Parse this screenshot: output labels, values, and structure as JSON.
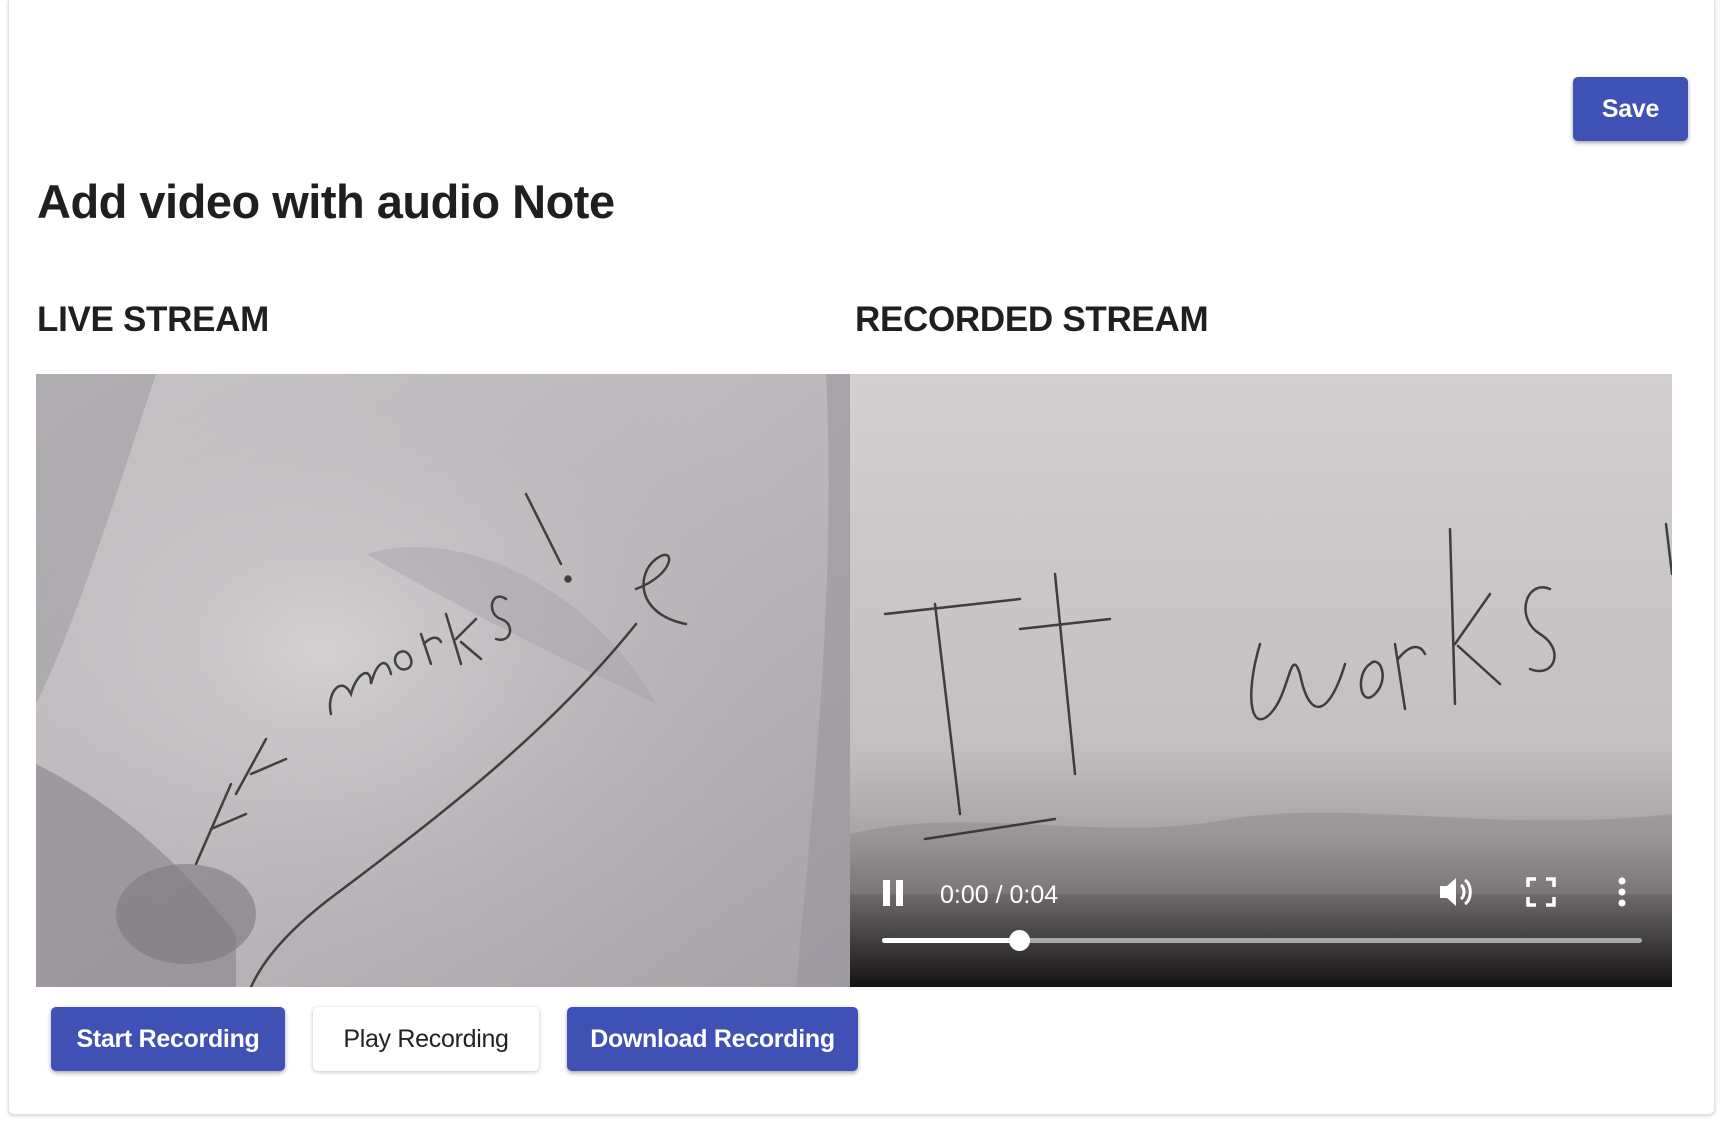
{
  "header": {
    "save_label": "Save",
    "title": "Add video with audio Note"
  },
  "live": {
    "label": "LIVE STREAM"
  },
  "recorded": {
    "label": "RECORDED STREAM",
    "time_display": "0:00 / 0:04",
    "progress_fraction": 0.18
  },
  "actions": {
    "start_label": "Start Recording",
    "play_label": "Play Recording",
    "download_label": "Download Recording"
  },
  "colors": {
    "primary": "#3f51b5",
    "title_text": "#1f1f1f"
  },
  "icons": {
    "pause": "pause-icon",
    "volume": "volume-icon",
    "fullscreen": "fullscreen-icon",
    "more": "more-vert-icon"
  }
}
